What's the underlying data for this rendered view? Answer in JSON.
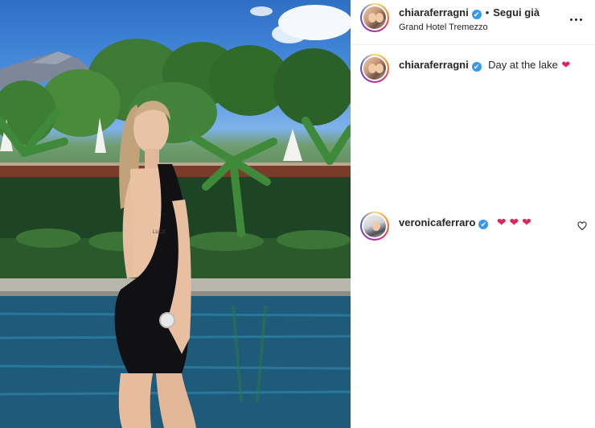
{
  "post": {
    "author": "chiaraferragni",
    "follow_label": "Segui già",
    "location": "Grand Hotel Tremezzo",
    "caption": "Day at the lake",
    "caption_emoji": "❤",
    "verified_glyph": "✔"
  },
  "comments": [
    {
      "username": "veronicaferraro",
      "text": "❤ ❤ ❤"
    }
  ],
  "photo": {
    "watch_text": "LUCE"
  },
  "icons": {
    "more": "more-options-icon",
    "verified": "verified-badge-icon",
    "like": "heart-outline-icon"
  },
  "colors": {
    "verified_blue": "#3897f0",
    "heart_red": "#e0245e",
    "text": "#262626"
  }
}
